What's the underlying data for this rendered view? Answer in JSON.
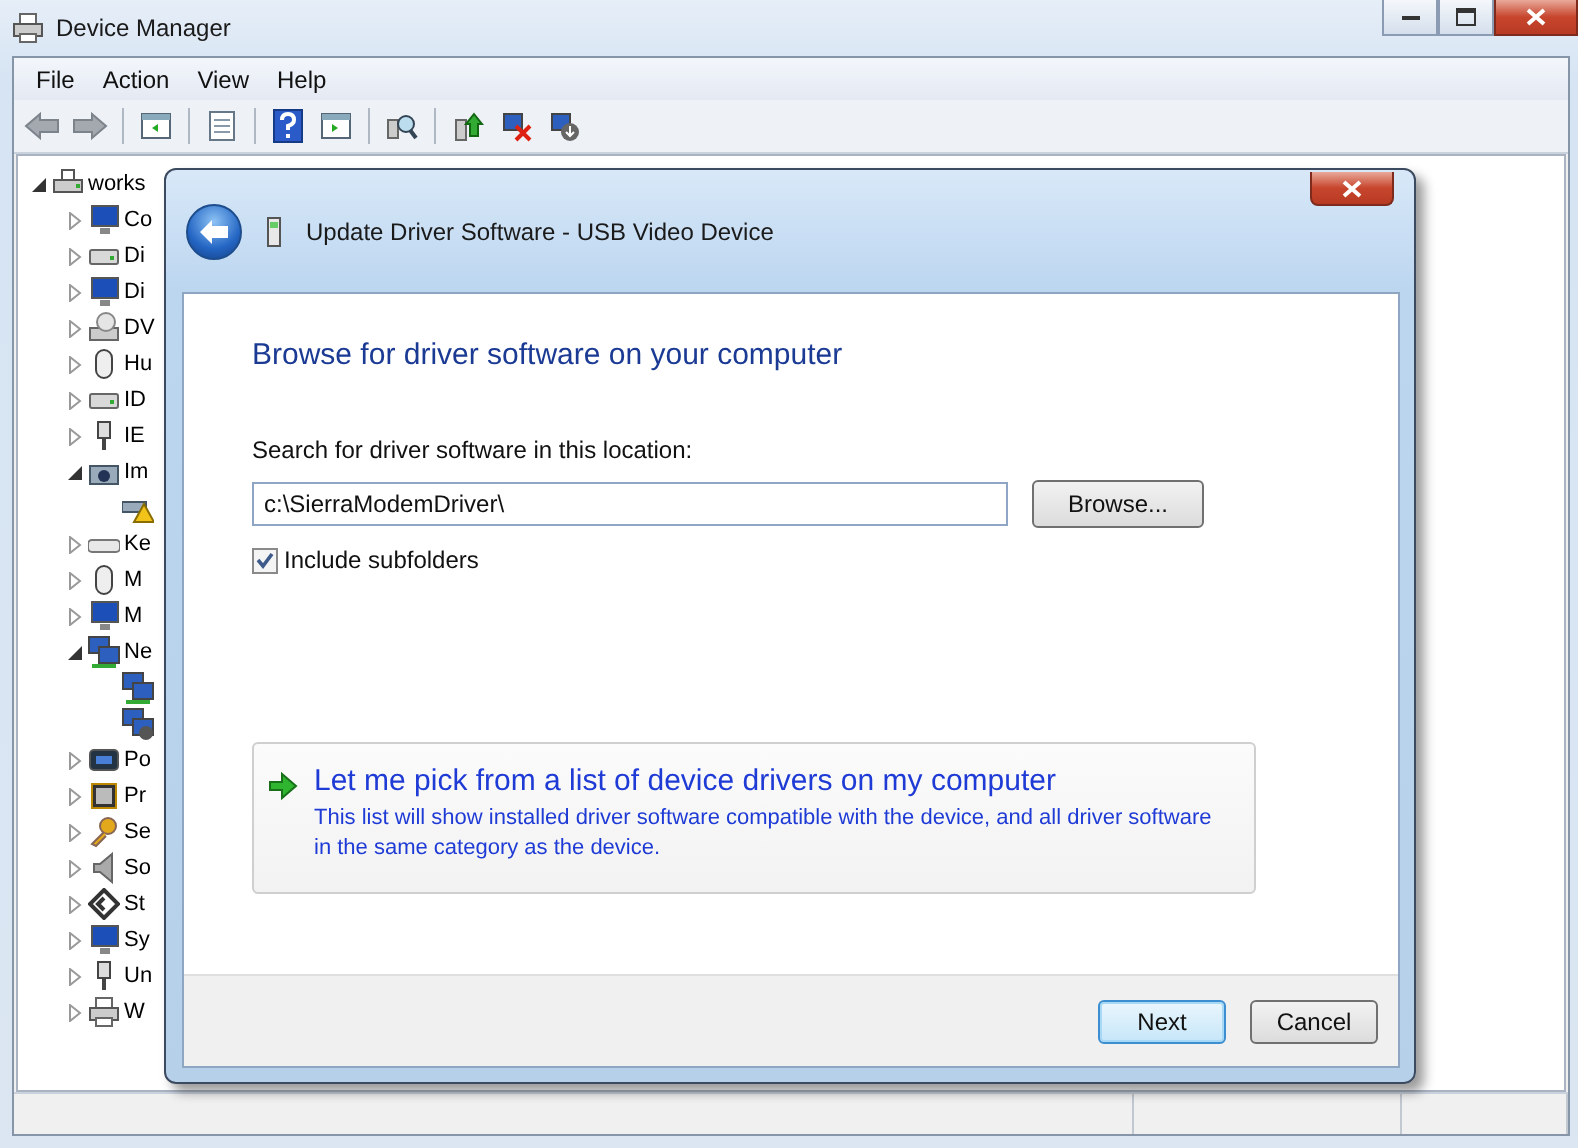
{
  "window": {
    "title": "Device Manager"
  },
  "menu": [
    "File",
    "Action",
    "View",
    "Help"
  ],
  "tree": {
    "label": "works",
    "expanded": true,
    "children": [
      {
        "label": "Co",
        "expanded": false
      },
      {
        "label": "Di",
        "expanded": false
      },
      {
        "label": "Di",
        "expanded": false
      },
      {
        "label": "DV",
        "expanded": false
      },
      {
        "label": "Hu",
        "expanded": false
      },
      {
        "label": "ID",
        "expanded": false
      },
      {
        "label": "IE",
        "expanded": false
      },
      {
        "label": "Im",
        "expanded": true,
        "children": [
          {
            "kind": "warning"
          }
        ]
      },
      {
        "label": "Ke",
        "expanded": false
      },
      {
        "label": "M",
        "expanded": false
      },
      {
        "label": "M",
        "expanded": false
      },
      {
        "label": "Ne",
        "expanded": true,
        "children": [
          {
            "kind": "plain"
          },
          {
            "kind": "down"
          }
        ]
      },
      {
        "label": "Po",
        "expanded": false
      },
      {
        "label": "Pr",
        "expanded": false
      },
      {
        "label": "Se",
        "expanded": false
      },
      {
        "label": "So",
        "expanded": false
      },
      {
        "label": "St",
        "expanded": false
      },
      {
        "label": "Sy",
        "expanded": false
      },
      {
        "label": "Un",
        "expanded": false
      },
      {
        "label": "W",
        "expanded": false
      }
    ]
  },
  "dialog": {
    "title": "Update Driver Software - USB Video Device",
    "heading": "Browse for driver software on your computer",
    "search_label": "Search for driver software in this location:",
    "path": "c:\\SierraModemDriver\\",
    "browse_button": "Browse...",
    "include_subfolders": {
      "label": "Include subfolders",
      "checked": true
    },
    "option": {
      "title": "Let me pick from a list of device drivers on my computer",
      "description": "This list will show installed driver software compatible with the device, and all driver software in the same category as the device."
    },
    "buttons": [
      {
        "label": "Next",
        "default": true
      },
      {
        "label": "Cancel",
        "default": false
      }
    ]
  }
}
